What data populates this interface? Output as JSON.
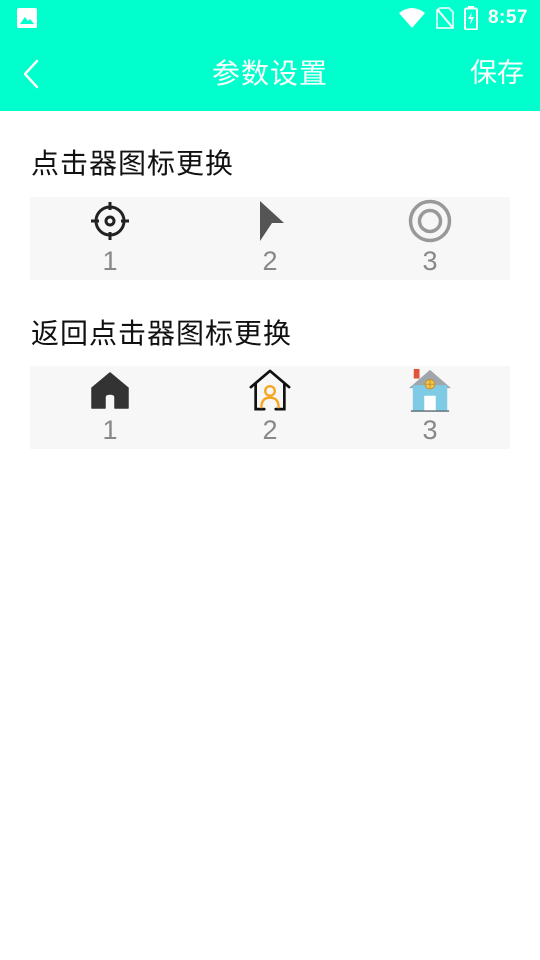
{
  "status_bar": {
    "time": "8:57",
    "icons": [
      "image-icon",
      "wifi-icon",
      "no-sim-icon",
      "battery-charging-icon"
    ]
  },
  "header": {
    "title": "参数设置",
    "save_label": "保存",
    "back_icon": "chevron-left-icon",
    "background_color": "#00FFCC"
  },
  "clicker_icons": {
    "title": "点击器图标更换",
    "options": [
      {
        "label": "1",
        "icon": "crosshair-icon"
      },
      {
        "label": "2",
        "icon": "arrow-pointer-icon"
      },
      {
        "label": "3",
        "icon": "double-circle-icon"
      }
    ]
  },
  "return_clicker_icons": {
    "title": "返回点击器图标更换",
    "options": [
      {
        "label": "1",
        "icon": "home-filled-icon"
      },
      {
        "label": "2",
        "icon": "home-person-icon"
      },
      {
        "label": "3",
        "icon": "house-colored-icon"
      }
    ]
  }
}
